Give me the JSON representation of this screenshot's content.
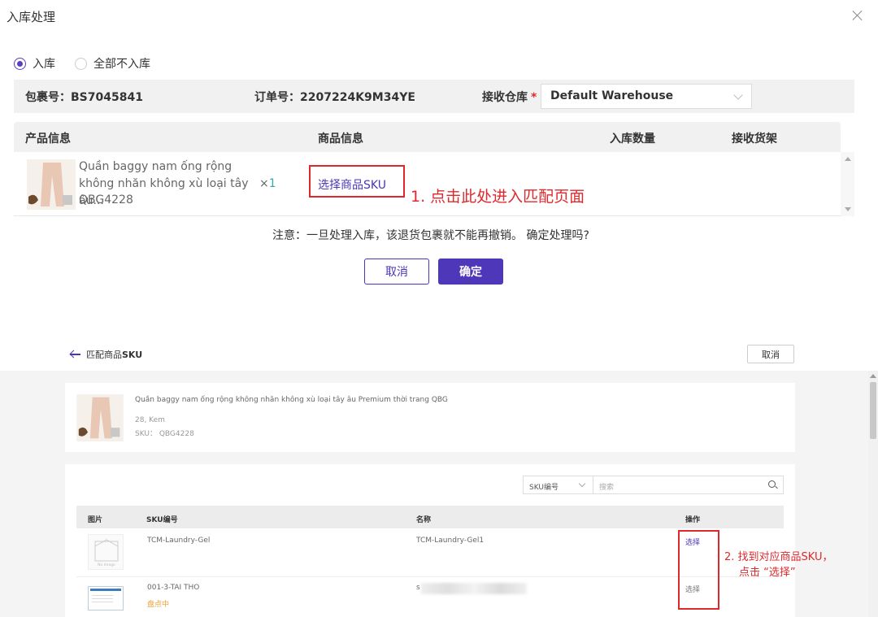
{
  "dialog": {
    "title": "入库处理",
    "radio_inbound": "入库",
    "radio_none": "全部不入库",
    "package_label": "包裹号：BS7045841",
    "order_label": "订单号：2207224K9M34YE",
    "warehouse_label": "接收仓库",
    "required_mark": "*",
    "warehouse_value": "Default Warehouse",
    "table_headers": [
      "产品信息",
      "商品信息",
      "入库数量",
      "接收货架"
    ],
    "product": {
      "name": "Quần baggy nam ống rộng không nhăn không xù loại tây âu...",
      "sku": "QBG4228",
      "qty_prefix": "×",
      "qty": "1"
    },
    "select_sku_link": "选择商品SKU",
    "annotation_1": "1. 点击此处进入匹配页面",
    "warning": "注意：一旦处理入库，该退货包裹就不能再撤销。 确定处理吗?",
    "cancel": "取消",
    "confirm": "确定"
  },
  "match_page": {
    "back_prefix": "匹配商品",
    "back_bold": "SKU",
    "cancel": "取消",
    "product_name": "Quần baggy nam ống rộng không nhăn không xù loại tây âu Premium thời trang QBG",
    "product_attr": "28, Kem",
    "product_sku": "SKU： QBG4228",
    "filter_value": "SKU编号",
    "search_placeholder": "搜索",
    "no_image_label": "No Image",
    "table_headers": [
      "图片",
      "SKU编号",
      "名称",
      "操作"
    ],
    "rows": [
      {
        "sku": "TCM-Laundry-Gel",
        "name": "TCM-Laundry-Gel1",
        "action": "选择"
      },
      {
        "sku": "001-3-TAI THO",
        "status": "盘点中",
        "name": "s",
        "action": "选择"
      }
    ],
    "annotation_2_line1": "2. 找到对应商品SKU，",
    "annotation_2_line2": "点击 “选择”",
    "colors": {
      "accent": "#4e37b8",
      "annotation": "#e0282c",
      "status_orange": "#f0a030"
    }
  }
}
